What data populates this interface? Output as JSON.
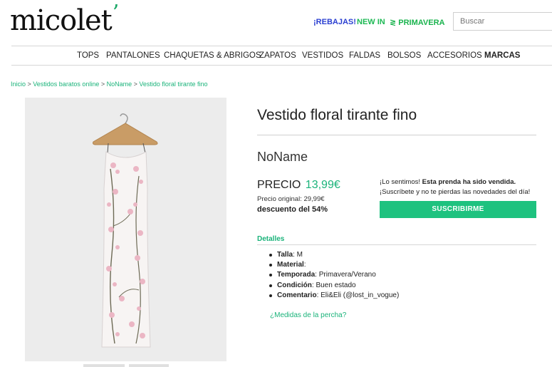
{
  "header": {
    "logo": "micolet",
    "logo_mark": "’",
    "promos": [
      "¡REBAJAS!",
      "NEW IN",
      "≷ PRIMAVERA"
    ],
    "search_placeholder": "Buscar"
  },
  "nav": {
    "items": [
      "TOPS",
      "PANTALONES",
      "CHAQUETAS & ABRIGOS",
      "ZAPATOS",
      "VESTIDOS",
      "FALDAS",
      "BOLSOS",
      "ACCESORIOS",
      "MARCAS"
    ]
  },
  "breadcrumb": [
    "Inicio",
    "Vestidos baratos online",
    "NoName",
    "Vestido floral tirante fino"
  ],
  "product": {
    "title": "Vestido floral tirante fino",
    "brand": "NoName",
    "price_label": "PRECIO",
    "price_value": "13,99€",
    "original_price": "Precio original: 29,99€",
    "discount": "descuento del 54%",
    "sold_prefix": "¡Lo sentimos! ",
    "sold_bold": "Esta prenda ha sido vendida.",
    "sold_line2": "¡Suscríbete y no te pierdas las novedades del día!",
    "subscribe_button": "SUSCRIBIRME"
  },
  "details": {
    "title": "Detalles",
    "items": [
      {
        "label": "Talla",
        "value": ": M"
      },
      {
        "label": "Material",
        "value": ":"
      },
      {
        "label": "Temporada",
        "value": ": Primavera/Verano"
      },
      {
        "label": "Condición",
        "value": ": Buen estado"
      },
      {
        "label": "Comentario",
        "value": ": Eli&Eli (@lost_in_vogue)"
      }
    ],
    "hanger_link": "¿Medidas de la percha?"
  },
  "colors": {
    "accent_green": "#1ab37a",
    "button_green": "#1ec27f",
    "rebajas_blue": "#2a3fd1"
  }
}
